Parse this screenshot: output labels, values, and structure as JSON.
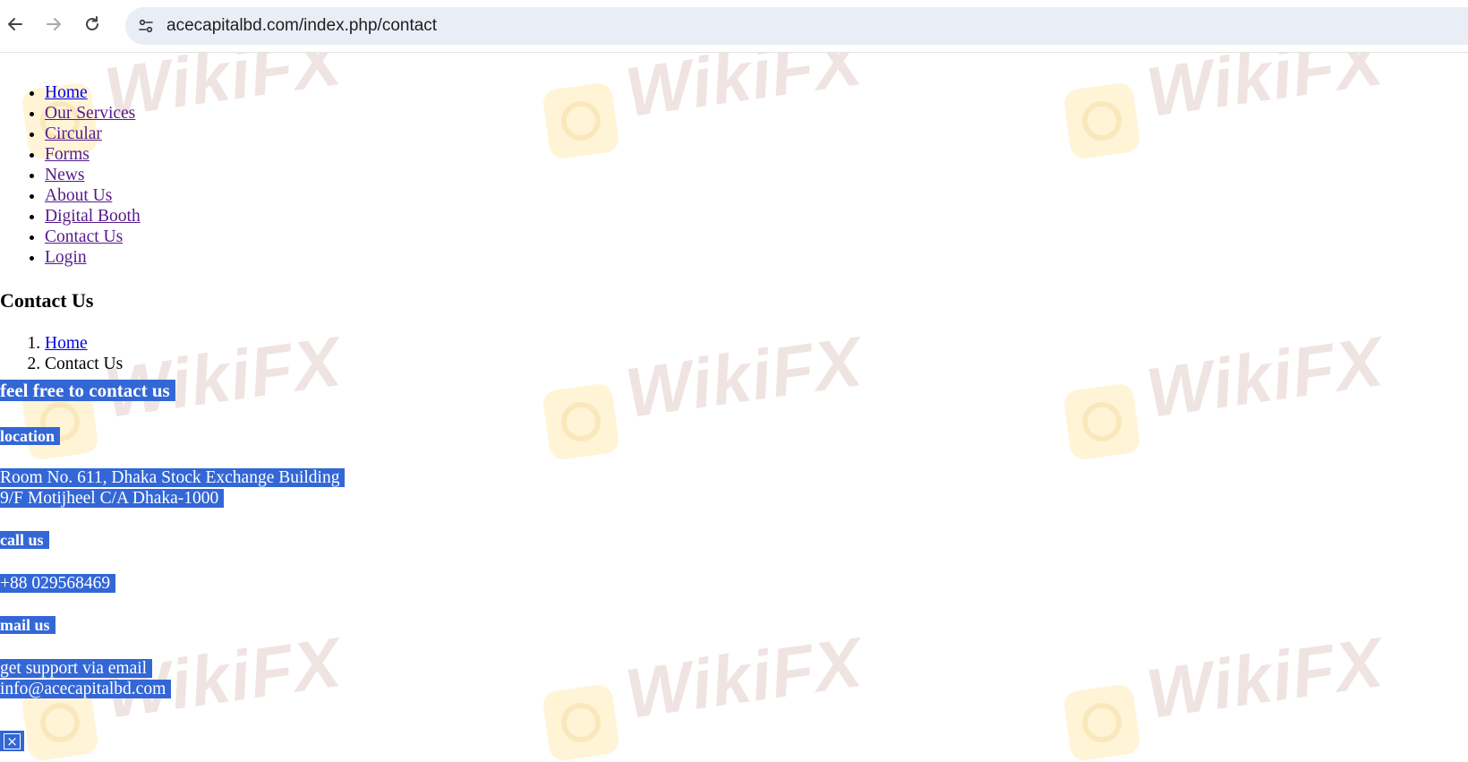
{
  "browser": {
    "url": "acecapitalbd.com/index.php/contact"
  },
  "nav": {
    "items": [
      {
        "label": "Home"
      },
      {
        "label": "Our Services"
      },
      {
        "label": "Circular"
      },
      {
        "label": "Forms"
      },
      {
        "label": "News"
      },
      {
        "label": "About Us"
      },
      {
        "label": "Digital Booth"
      },
      {
        "label": "Contact Us"
      },
      {
        "label": "Login"
      }
    ]
  },
  "page": {
    "title": "Contact Us",
    "breadcrumb": [
      {
        "label": "Home"
      },
      {
        "label": "Contact Us"
      }
    ]
  },
  "contact": {
    "heading": "feel free to contact us",
    "location_label": "location",
    "address_line1": "Room No. 611, Dhaka Stock Exchange Building",
    "address_line2": "9/F Motijheel C/A Dhaka-1000",
    "call_label": "call us",
    "phone": "+88 029568469",
    "mail_label": "mail us",
    "mail_desc": "get support via email",
    "email": "info@acecapitalbd.com",
    "close_glyph": "×"
  },
  "watermark": {
    "text": "WikiFX"
  },
  "colors": {
    "selection": "#3367d6",
    "link": "#0000ee",
    "visited_link": "#551a8b",
    "omnibox": "#e9edf6"
  }
}
